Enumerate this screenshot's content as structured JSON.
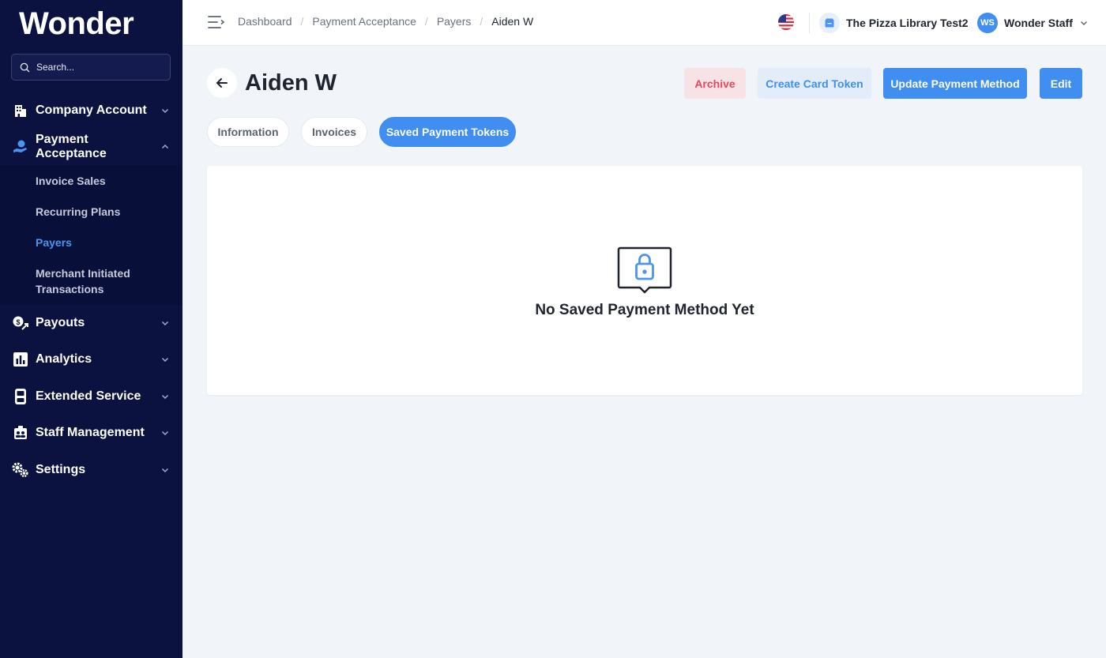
{
  "app": {
    "logo": "Wonder"
  },
  "search": {
    "placeholder": "Search..."
  },
  "sidebar": {
    "items": [
      {
        "label": "Company Account",
        "icon": "building-icon"
      },
      {
        "label": "Payment Acceptance",
        "icon": "hand-payment-icon",
        "expanded": true
      },
      {
        "label": "Payouts",
        "icon": "payout-icon"
      },
      {
        "label": "Analytics",
        "icon": "bar-chart-icon"
      },
      {
        "label": "Extended Service",
        "icon": "terminal-icon"
      },
      {
        "label": "Staff Management",
        "icon": "staff-icon"
      },
      {
        "label": "Settings",
        "icon": "gears-icon"
      }
    ],
    "sub_items": [
      {
        "label": "Invoice Sales"
      },
      {
        "label": "Recurring Plans"
      },
      {
        "label": "Payers",
        "active": true
      },
      {
        "label": "Merchant Initiated Transactions"
      }
    ]
  },
  "breadcrumb": [
    "Dashboard",
    "Payment Acceptance",
    "Payers",
    "Aiden W"
  ],
  "topbar": {
    "company_name": "The Pizza Library Test2",
    "user_initials": "WS",
    "user_name": "Wonder Staff"
  },
  "page": {
    "title": "Aiden W",
    "actions": {
      "archive": "Archive",
      "create_token": "Create Card Token",
      "update_method": "Update Payment Method",
      "edit": "Edit"
    },
    "tabs": [
      {
        "label": "Information"
      },
      {
        "label": "Invoices"
      },
      {
        "label": "Saved Payment Tokens",
        "active": true
      }
    ],
    "empty_state": "No Saved Payment Method Yet"
  },
  "colors": {
    "sidebar_bg": "#0b1240",
    "accent": "#3f8ef0",
    "danger": "#e0495b"
  }
}
